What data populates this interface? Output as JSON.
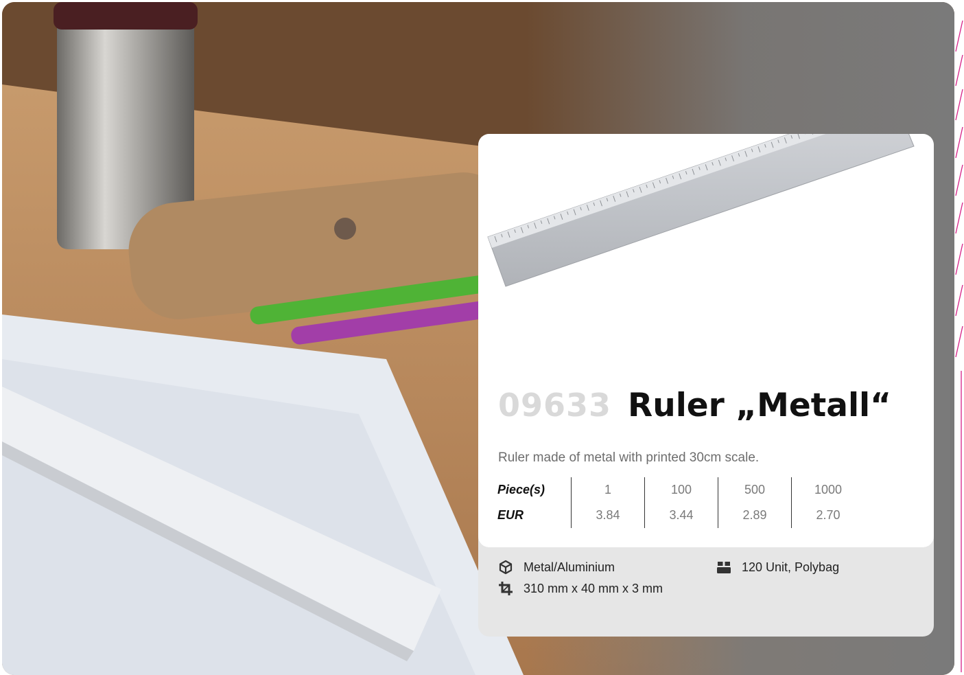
{
  "product": {
    "sku": "09633",
    "name": "Ruler „Metall“",
    "description": "Ruler made of metal with printed 30cm scale."
  },
  "pricing": {
    "qty_label": "Piece(s)",
    "price_label": "EUR",
    "quantities": [
      "1",
      "100",
      "500",
      "1000"
    ],
    "prices": [
      "3.84",
      "3.44",
      "2.89",
      "2.70"
    ]
  },
  "specs": {
    "material": {
      "icon": "box-icon",
      "text": "Metal/Aluminium"
    },
    "dimensions": {
      "icon": "crop-icon",
      "text": "310 mm x 40 mm x 3 mm"
    },
    "packaging": {
      "icon": "package-icon",
      "text": "120 Unit, Polybag"
    }
  },
  "colors": {
    "accent_lines": "#d61f86",
    "sku_gray": "#d9d9d9",
    "card_gray": "#e6e6e6"
  }
}
